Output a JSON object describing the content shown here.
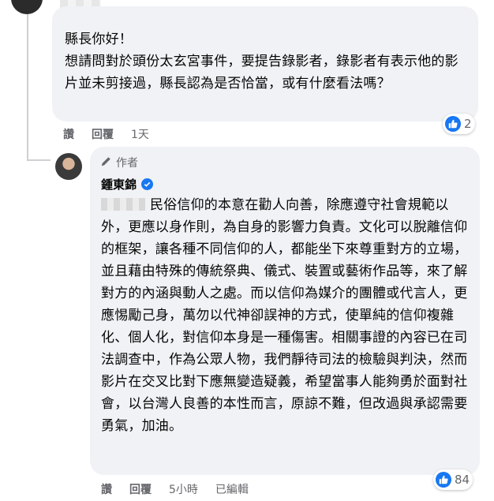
{
  "comment1": {
    "text": "縣長你好！\n想請問對於頭份太玄宮事件，要提告錄影者，錄影者有表示他的影片並未剪接過，縣長認為是否恰當，或有什麼看法嗎？",
    "actions": {
      "like": "讚",
      "reply": "回覆",
      "time": "1天"
    },
    "reaction_count": "2"
  },
  "reply": {
    "author_badge": "作者",
    "author_name": "鍾東錦",
    "text": "民俗信仰的本意在勸人向善，除應遵守社會規範以外，更應以身作則，為自身的影響力負責。文化可以脫離信仰的框架，讓各種不同信仰的人，都能坐下來尊重對方的立場，並且藉由特殊的傳統祭典、儀式、裝置或藝術作品等，來了解對方的內涵與動人之處。而以信仰為媒介的團體或代言人，更應惕勵己身，萬勿以代神卻誤神的方式，使單純的信仰複雜化、個人化，對信仰本身是一種傷害。相關事證的內容已在司法調查中，作為公眾人物，我們靜待司法的檢驗與判決，然而影片在交叉比對下應無變造疑義，希望當事人能夠勇於面對社會，以台灣人良善的本性而言，原諒不難，但改過與承認需要勇氣，加油。",
    "actions": {
      "like": "讚",
      "reply": "回覆",
      "time": "5小時",
      "edited": "已編輯"
    },
    "reaction_count": "84"
  },
  "colors": {
    "bubble": "#f0f2f5",
    "meta": "#65676b",
    "like": "#1877f2"
  }
}
